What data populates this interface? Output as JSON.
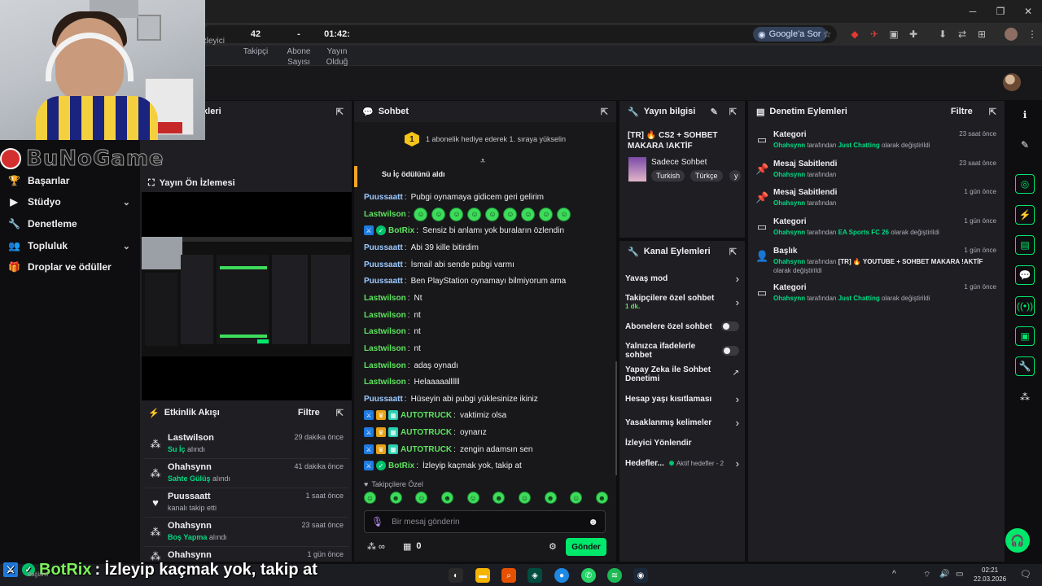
{
  "browser": {
    "google_button": "Google'a Sor"
  },
  "overlay": {
    "brand": "BuNoGame",
    "message_user": "BotRix",
    "message_text": ": İzleyip kaçmak yok, takip at",
    "conn_status": "Bağlantı"
  },
  "sidebar": {
    "items": [
      {
        "label": "Başarılar",
        "icon": "trophy-icon"
      },
      {
        "label": "Stüdyo",
        "icon": "video-icon",
        "expandable": true
      },
      {
        "label": "Denetleme",
        "icon": "wrench-icon"
      },
      {
        "label": "Topluluk",
        "icon": "people-icon",
        "expandable": true
      },
      {
        "label": "Droplar ve ödüller",
        "icon": "gift-icon"
      }
    ]
  },
  "stats": {
    "title_fragment": "ikleri",
    "items": [
      {
        "value": "",
        "label": "İzleyici"
      },
      {
        "value": "42",
        "label": "Takipçi"
      },
      {
        "value": "-",
        "label": "Abone Sayısı"
      },
      {
        "value": "01:42:",
        "label": "Yayın Olduğ"
      }
    ],
    "left_label": "n"
  },
  "preview": {
    "title": "Yayın Ön İzlemesi"
  },
  "activity": {
    "title": "Etkinlik Akışı",
    "filter": "Filtre",
    "items": [
      {
        "name": "Lastwilson",
        "reward": "Su İç",
        "suffix": " alındı",
        "time": "29 dakika önce",
        "icon": "reward-icon"
      },
      {
        "name": "Ohahsynn",
        "reward": "Sahte Gülüş",
        "suffix": " alındı",
        "time": "41 dakika önce",
        "icon": "reward-icon"
      },
      {
        "name": "Puussaatt",
        "reward": "",
        "suffix": "kanalı takip etti",
        "time": "1 saat önce",
        "icon": "heart-icon"
      },
      {
        "name": "Ohahsynn",
        "reward": "Boş Yapma",
        "suffix": " alındı",
        "time": "23 saat önce",
        "icon": "reward-icon"
      },
      {
        "name": "Ohahsynn",
        "reward": "",
        "suffix": "",
        "time": "1 gün önce",
        "icon": "reward-icon"
      }
    ]
  },
  "chat": {
    "title": "Sohbet",
    "hype_badge": "1",
    "hype_text": "1 abonelik hediye ederek 1. sıraya yükselin",
    "gift_text": "Su İç ödülünü aldı",
    "messages": [
      {
        "user": "Puussaatt",
        "color": "blue",
        "text": "Pubgi oynamaya gidicem geri gelirim"
      },
      {
        "user": "Lastwilson",
        "color": "green",
        "text": "",
        "emotes": 9
      },
      {
        "user": "BotRix",
        "color": "auto",
        "badges": [
          "mod",
          "verified"
        ],
        "text": "Sensiz bi anlamı yok buraların özlendin"
      },
      {
        "user": "Puussaatt",
        "color": "blue",
        "text": "Abi 39 kille bitirdim"
      },
      {
        "user": "Puussaatt",
        "color": "blue",
        "text": "İsmail abi sende pubgi varmı"
      },
      {
        "user": "Puussaatt",
        "color": "blue",
        "text": "Ben PlayStation oynamayı bilmiyorum ama"
      },
      {
        "user": "Lastwilson",
        "color": "green",
        "text": "Nt"
      },
      {
        "user": "Lastwilson",
        "color": "green",
        "text": "nt"
      },
      {
        "user": "Lastwilson",
        "color": "green",
        "text": "nt"
      },
      {
        "user": "Lastwilson",
        "color": "green",
        "text": "nt"
      },
      {
        "user": "Lastwilson",
        "color": "green",
        "text": "adaş oynadı"
      },
      {
        "user": "Lastwilson",
        "color": "green",
        "text": "Helaaaaallllll"
      },
      {
        "user": "Puussaatt",
        "color": "blue",
        "text": "Hüseyin abi pubgi yüklesinize ikiniz"
      },
      {
        "user": "AUTOTRUCK",
        "color": "auto",
        "badges": [
          "mod",
          "crown",
          "sub"
        ],
        "text": "vaktimiz olsa"
      },
      {
        "user": "AUTOTRUCK",
        "color": "auto",
        "badges": [
          "mod",
          "crown",
          "sub"
        ],
        "text": "oynarız"
      },
      {
        "user": "AUTOTRUCK",
        "color": "auto",
        "badges": [
          "mod",
          "crown",
          "sub"
        ],
        "text": "zengin adamsın sen"
      },
      {
        "user": "BotRix",
        "color": "auto",
        "badges": [
          "mod",
          "verified"
        ],
        "text": "İzleyip kaçmak yok, takip at"
      }
    ],
    "follow_only_label": "Takipçilere Özel",
    "input_placeholder": "Bir mesaj gönderin",
    "points_value": "0",
    "send_label": "Gönder"
  },
  "stream_info": {
    "title": "Yayın bilgisi",
    "stream_title": "[TR] 🔥 CS2 + SOHBET MAKARA !AKTİF",
    "category": "Sadece Sohbet",
    "tags": [
      "Turkish",
      "Türkçe",
      "y"
    ]
  },
  "channel_actions": {
    "title": "Kanal Eylemleri",
    "rows": [
      {
        "label": "Yavaş mod",
        "type": "chevron"
      },
      {
        "label": "Takipçilere özel sohbet",
        "sub": "1 dk.",
        "type": "chevron"
      },
      {
        "label": "Abonelere özel sohbet",
        "type": "toggle"
      },
      {
        "label": "Yalnızca ifadelerle sohbet",
        "type": "toggle"
      },
      {
        "label": "Yapay Zeka ile Sohbet Denetimi",
        "type": "external"
      },
      {
        "label": "Hesap yaşı kısıtlaması",
        "type": "chevron"
      },
      {
        "label": "Yasaklanmış kelimeler",
        "type": "chevron"
      },
      {
        "label": "İzleyici Yönlendir",
        "type": "none"
      },
      {
        "label": "Hedefler...",
        "sub_inline": "Aktif hedefler - 2",
        "type": "chevron"
      }
    ]
  },
  "mod_actions": {
    "title": "Denetim Eylemleri",
    "filter": "Filtre",
    "items": [
      {
        "title": "Kategori",
        "time": "23 saat önce",
        "who": "Ohahsynn",
        "mid": " tarafından ",
        "value": "Just Chatting",
        "end": " olarak değiştirildi",
        "icon": "category-icon"
      },
      {
        "title": "Mesaj Sabitlendi",
        "time": "23 saat önce",
        "who": "Ohahsynn",
        "mid": " tarafından",
        "value": "",
        "end": "",
        "icon": "pin-icon"
      },
      {
        "title": "Mesaj Sabitlendi",
        "time": "1 gün önce",
        "who": "Ohahsynn",
        "mid": " tarafından",
        "value": "",
        "end": "",
        "icon": "pin-icon"
      },
      {
        "title": "Kategori",
        "time": "1 gün önce",
        "who": "Ohahsynn",
        "mid": " tarafından ",
        "value": "EA Sports FC 26",
        "end": " olarak değiştirildi",
        "icon": "category-icon"
      },
      {
        "title": "Başlık",
        "time": "1 gün önce",
        "who": "Ohahsynn",
        "mid": " tarafından ",
        "value_white": "[TR] 🔥 YOUTUBE + SOHBET MAKARA !AKTİF",
        "end": " olarak değiştirildi",
        "icon": "title-icon"
      },
      {
        "title": "Kategori",
        "time": "1 gün önce",
        "who": "Ohahsynn",
        "mid": " tarafından ",
        "value": "Just Chatting",
        "end": " olarak değiştirildi",
        "icon": "category-icon"
      }
    ]
  },
  "taskbar": {
    "time": "02:21",
    "date": "22.03.2026"
  },
  "colors": {
    "accent": "#00e86b",
    "bg": "#0e0e10",
    "panel": "#1f1f23"
  }
}
